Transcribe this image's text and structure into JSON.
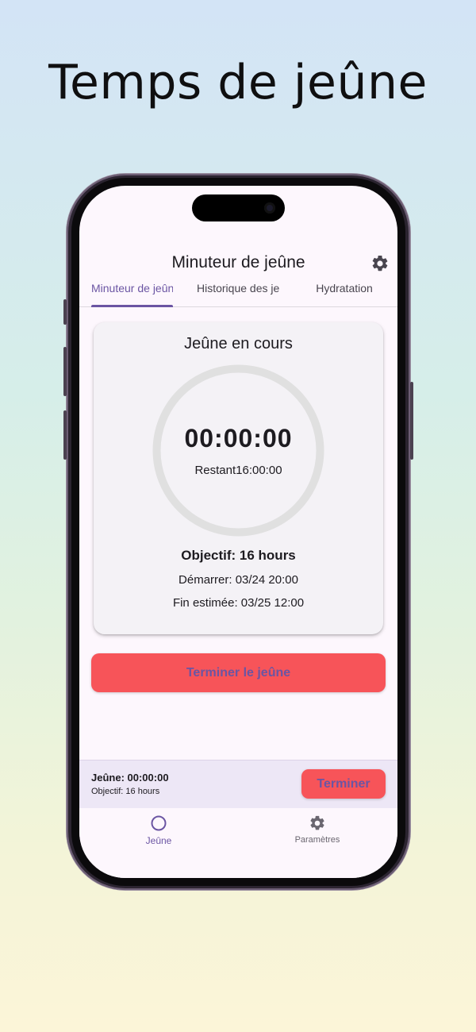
{
  "hero": {
    "title": "Temps de jeûne"
  },
  "app": {
    "title": "Minuteur de jeûne",
    "settings_icon": "gear-icon"
  },
  "tabs": [
    {
      "label": "Minuteur de jeûne",
      "active": true
    },
    {
      "label": "Historique des jeûnes",
      "active": false
    },
    {
      "label": "Hydratation",
      "active": false
    }
  ],
  "card": {
    "title": "Jeûne en cours",
    "timer": "00:00:00",
    "remaining": "Restant16:00:00",
    "progress": 0,
    "goal": "Objectif: 16 hours",
    "start": "Démarrer: 03/24 20:00",
    "estimated_end": "Fin estimée: 03/25 12:00"
  },
  "end_button_label": "Terminer le jeûne",
  "mini_bar": {
    "time": "Jeûne: 00:00:00",
    "goal": "Objectif: 16 hours",
    "button_label": "Terminer"
  },
  "bottom_nav": [
    {
      "label": "Jeûne",
      "icon": "circle-icon",
      "active": true
    },
    {
      "label": "Paramètres",
      "icon": "gear-icon",
      "active": false
    }
  ],
  "colors": {
    "accent": "#6b55a3",
    "danger": "#f75459",
    "ring_track": "#e0e0e0",
    "surface": "#fdf7fd",
    "mini_bar_bg": "#ede7f6"
  }
}
